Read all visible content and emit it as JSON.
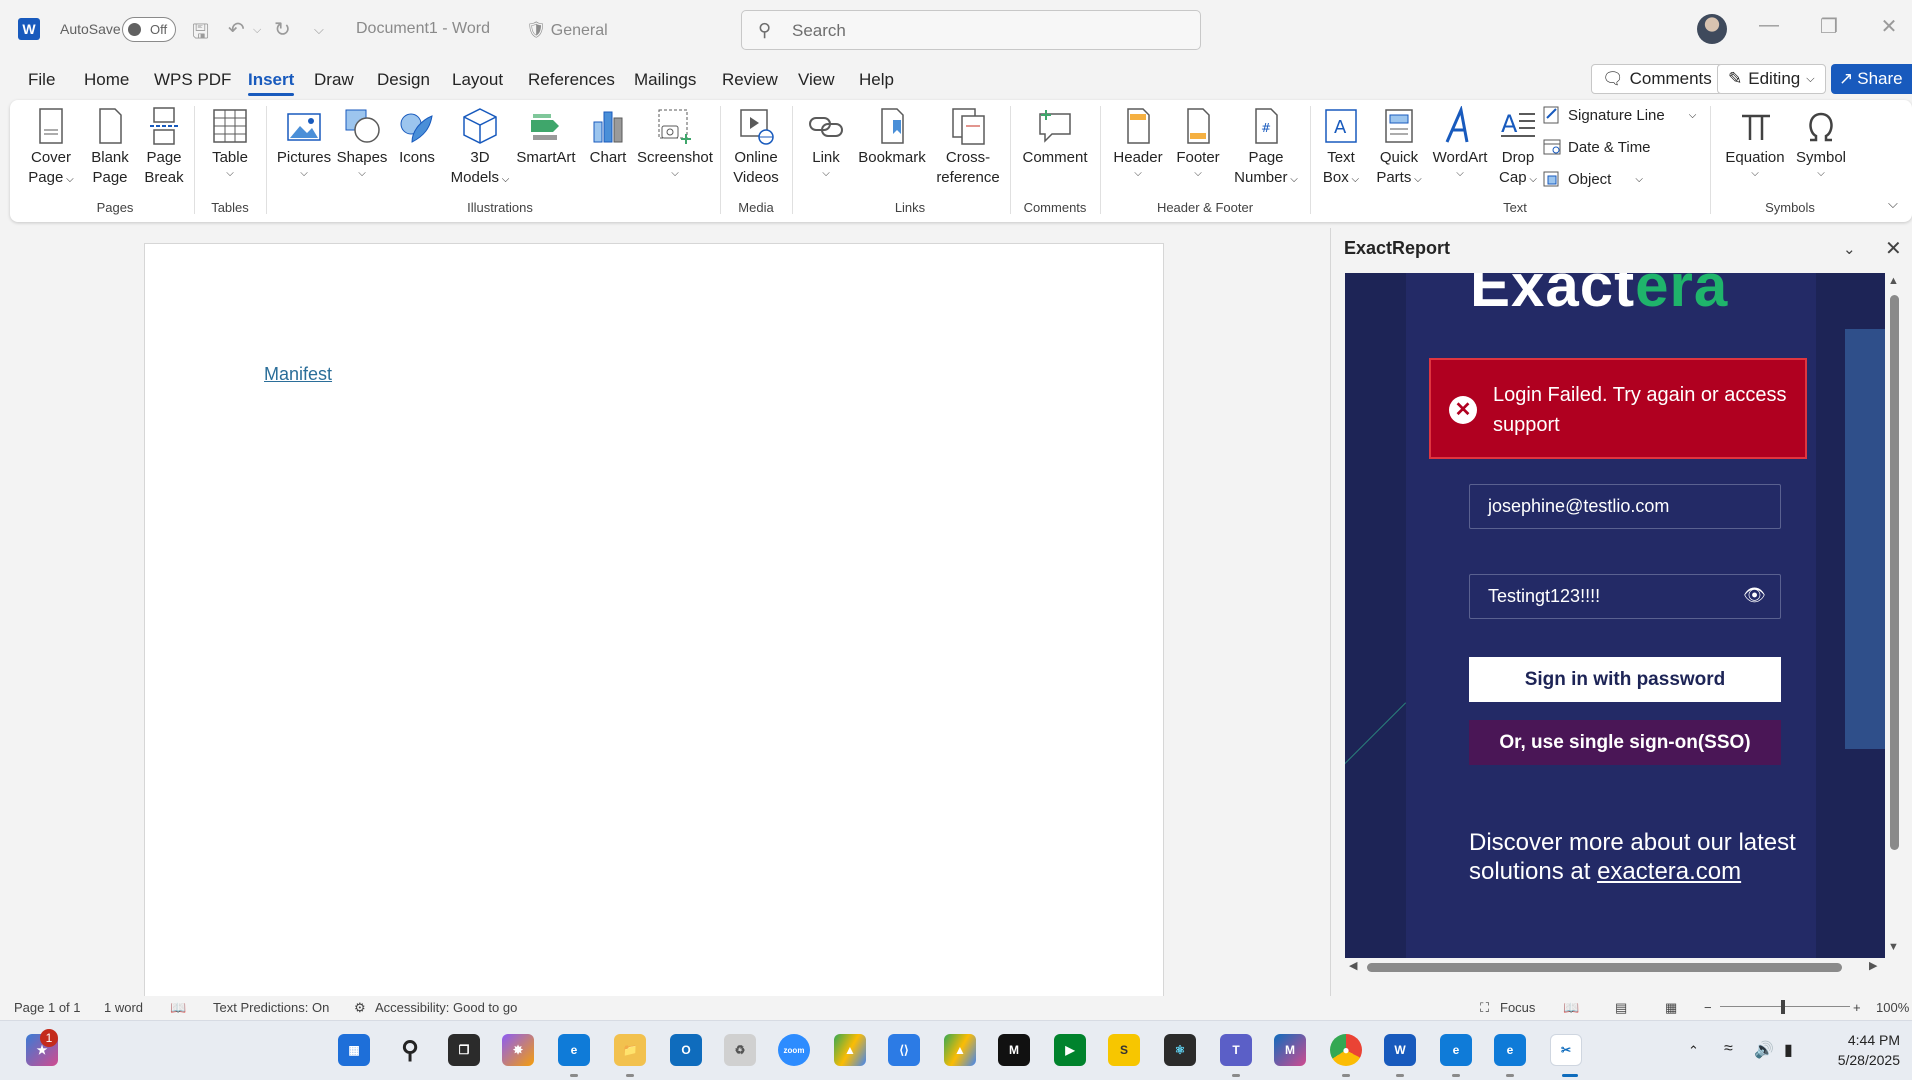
{
  "titlebar": {
    "autosave_label": "AutoSave",
    "autosave_state": "Off",
    "doc_title": "Document1 - Word",
    "sensitivity": "General",
    "search_placeholder": "Search"
  },
  "menu": {
    "tabs": [
      "File",
      "Home",
      "WPS PDF",
      "Insert",
      "Draw",
      "Design",
      "Layout",
      "References",
      "Mailings",
      "Review",
      "View",
      "Help"
    ],
    "active": "Insert",
    "comments_label": "Comments",
    "editing_label": "Editing",
    "share_label": "Share"
  },
  "ribbon": {
    "cover_page": "Cover Page",
    "cover_page_l1": "Cover",
    "cover_page_l2": "Page",
    "blank_page_l1": "Blank",
    "blank_page_l2": "Page",
    "page_break_l1": "Page",
    "page_break_l2": "Break",
    "table": "Table",
    "pictures": "Pictures",
    "shapes": "Shapes",
    "icons": "Icons",
    "models_l1": "3D",
    "models_l2": "Models",
    "smartart": "SmartArt",
    "chart": "Chart",
    "screenshot": "Screenshot",
    "online_videos_l1": "Online",
    "online_videos_l2": "Videos",
    "link": "Link",
    "bookmark": "Bookmark",
    "crossref_l1": "Cross-",
    "crossref_l2": "reference",
    "comment": "Comment",
    "header": "Header",
    "footer": "Footer",
    "page_number_l1": "Page",
    "page_number_l2": "Number",
    "text_box_l1": "Text",
    "text_box_l2": "Box",
    "quick_parts_l1": "Quick",
    "quick_parts_l2": "Parts",
    "wordart": "WordArt",
    "drop_cap_l1": "Drop",
    "drop_cap_l2": "Cap",
    "signature_line": "Signature Line",
    "date_time": "Date & Time",
    "object": "Object",
    "equation": "Equation",
    "symbol": "Symbol",
    "groups": {
      "pages": "Pages",
      "tables": "Tables",
      "illustrations": "Illustrations",
      "media": "Media",
      "links": "Links",
      "comments": "Comments",
      "header_footer": "Header & Footer",
      "text": "Text",
      "symbols": "Symbols"
    }
  },
  "document": {
    "link_text": "Manifest"
  },
  "pane": {
    "title": "ExactReport",
    "logo_white": "Exact",
    "logo_green": "era",
    "error_message": "Login Failed. Try again or access support",
    "email_value": "josephine@testlio.com",
    "password_value": "Testingt123!!!!",
    "sign_in_label": "Sign in with password",
    "sso_label": "Or, use single sign-on(SSO)",
    "promo_text": "Discover more about our latest solutions at",
    "promo_link": "exactera.com"
  },
  "statusbar": {
    "page": "Page 1 of 1",
    "words": "1 word",
    "text_predictions": "Text Predictions: On",
    "accessibility": "Accessibility: Good to go",
    "focus": "Focus",
    "zoom": "100%"
  },
  "taskbar": {
    "notification_count": "1",
    "time": "4:44 PM",
    "date": "5/28/2025"
  },
  "colors": {
    "word_blue": "#185abd",
    "addin_bg": "#1d2456",
    "error_red": "#b00020",
    "sso_purple": "#4a1656",
    "brand_green": "#1fb46b"
  }
}
